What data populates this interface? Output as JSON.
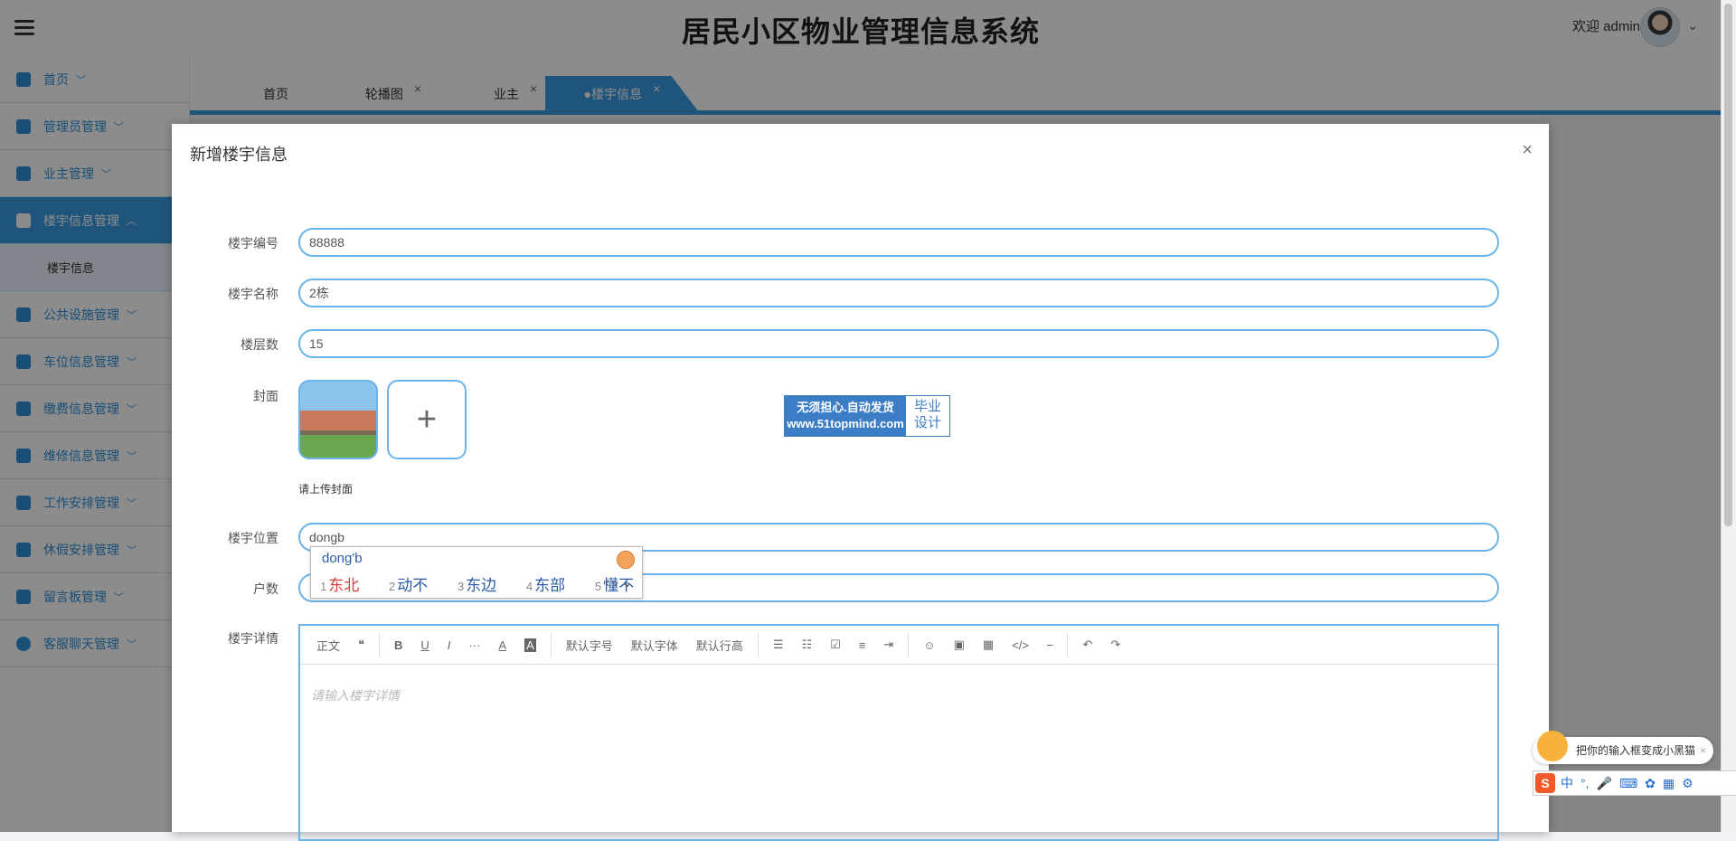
{
  "header": {
    "title": "居民小区物业管理信息系统",
    "welcome": "欢迎 admin"
  },
  "sidebar": {
    "items": [
      {
        "label": "首页"
      },
      {
        "label": "管理员管理"
      },
      {
        "label": "业主管理"
      },
      {
        "label": "楼宇信息管理",
        "active": true
      },
      {
        "label": "公共设施管理"
      },
      {
        "label": "车位信息管理"
      },
      {
        "label": "缴费信息管理"
      },
      {
        "label": "维修信息管理"
      },
      {
        "label": "工作安排管理"
      },
      {
        "label": "休假安排管理"
      },
      {
        "label": "留言板管理"
      },
      {
        "label": "客服聊天管理"
      }
    ],
    "sub_item": "楼宇信息"
  },
  "tabs": [
    {
      "label": "首页",
      "closable": false
    },
    {
      "label": "轮播图",
      "closable": true
    },
    {
      "label": "业主",
      "closable": true
    },
    {
      "label": "●楼宇信息",
      "closable": true,
      "active": true
    }
  ],
  "modal": {
    "title": "新增楼宇信息",
    "close": "×",
    "fields": {
      "code_label": "楼宇编号",
      "code_value": "88888",
      "name_label": "楼宇名称",
      "name_value": "2栋",
      "floors_label": "楼层数",
      "floors_value": "15",
      "cover_label": "封面",
      "cover_tip": "请上传封面",
      "add_symbol": "+",
      "location_label": "楼宇位置",
      "location_value": "dongb",
      "households_label": "户数",
      "detail_label": "楼宇详情",
      "detail_placeholder": "请输入楼宇详情"
    },
    "ad": {
      "line1": "无须担心.自动发货",
      "line2": "www.51topmind.com",
      "right1": "毕业",
      "right2": "设计"
    },
    "editor_toolbar": [
      "正文",
      "❝",
      "B",
      "U",
      "I",
      "···",
      "A",
      "A",
      "默认字号",
      "默认字体",
      "默认行高",
      "☰",
      "☷",
      "☑",
      "≡",
      "⇥",
      "☺",
      "▣",
      "▦",
      "</>",
      "⎯"
    ]
  },
  "ime": {
    "composition": "dong'b",
    "candidates": [
      {
        "n": "1",
        "w": "东北"
      },
      {
        "n": "2",
        "w": "动不"
      },
      {
        "n": "3",
        "w": "东边"
      },
      {
        "n": "4",
        "w": "东部"
      },
      {
        "n": "5",
        "w": "懂不"
      }
    ]
  },
  "sogou": {
    "tip": "把你的输入框变成小黑猫",
    "lang": "中",
    "punct": "°,"
  },
  "colors": {
    "accent": "#3b9be0",
    "input_border": "#6bb4e8"
  }
}
